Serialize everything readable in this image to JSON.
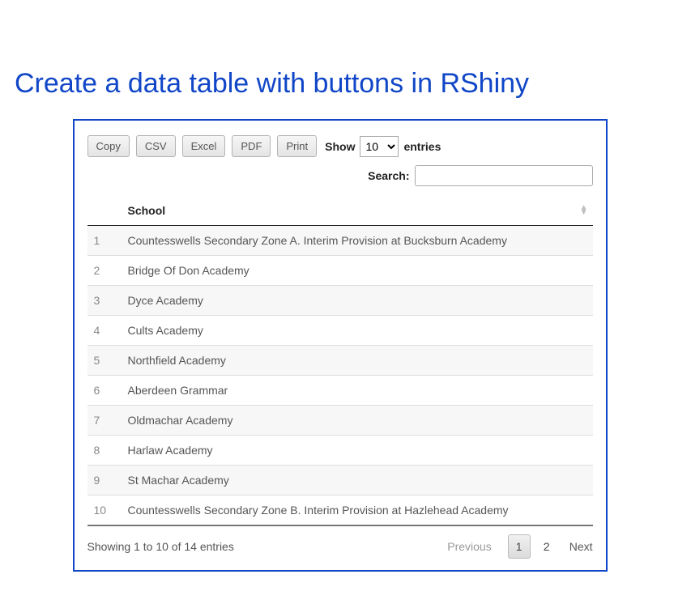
{
  "page": {
    "title": "Create a data table with buttons in RShiny"
  },
  "buttons": {
    "copy": "Copy",
    "csv": "CSV",
    "excel": "Excel",
    "pdf": "PDF",
    "print": "Print"
  },
  "length": {
    "prefix": "Show",
    "value": "10",
    "suffix": "entries"
  },
  "search": {
    "label": "Search:",
    "value": ""
  },
  "table": {
    "columns": {
      "idx": "",
      "school": "School"
    },
    "rows": [
      {
        "idx": "1",
        "school": "Countesswells Secondary Zone A. Interim Provision at Bucksburn Academy"
      },
      {
        "idx": "2",
        "school": "Bridge Of Don Academy"
      },
      {
        "idx": "3",
        "school": "Dyce Academy"
      },
      {
        "idx": "4",
        "school": "Cults Academy"
      },
      {
        "idx": "5",
        "school": "Northfield Academy"
      },
      {
        "idx": "6",
        "school": "Aberdeen Grammar"
      },
      {
        "idx": "7",
        "school": "Oldmachar Academy"
      },
      {
        "idx": "8",
        "school": "Harlaw Academy"
      },
      {
        "idx": "9",
        "school": "St Machar Academy"
      },
      {
        "idx": "10",
        "school": "Countesswells Secondary Zone B. Interim Provision at Hazlehead Academy"
      }
    ]
  },
  "footer": {
    "info": "Showing 1 to 10 of 14 entries"
  },
  "pagination": {
    "previous": "Previous",
    "next": "Next",
    "pages": [
      "1",
      "2"
    ],
    "current": "1"
  }
}
